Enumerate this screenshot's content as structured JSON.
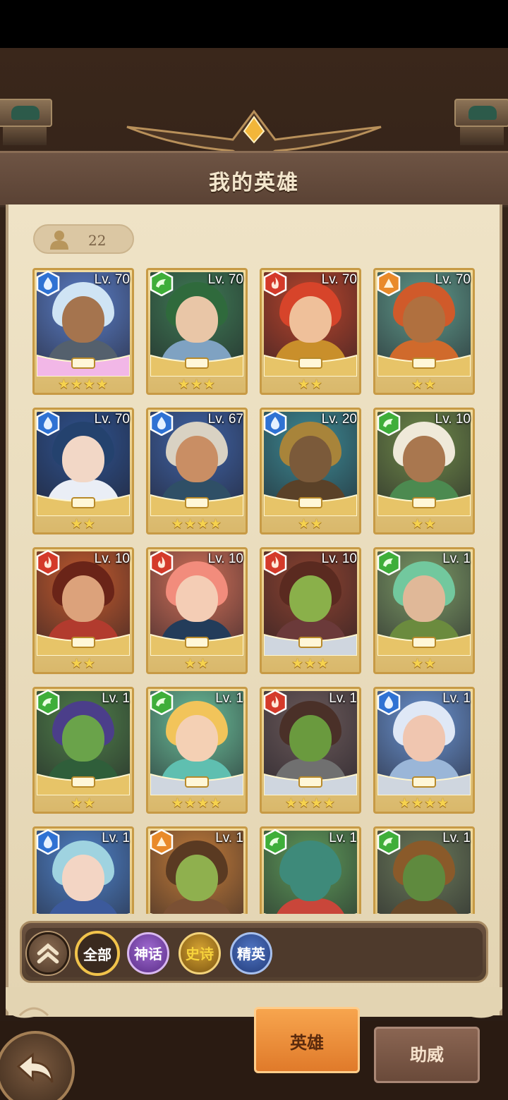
{
  "header": {
    "title": "我的英雄"
  },
  "hero_count": "22",
  "heroes": [
    {
      "level": "Lv. 70",
      "element": "water",
      "stars": "★★★★",
      "bg": "#5a7ec7",
      "hair": "#cfe4f4",
      "skin": "#a5744e",
      "outfit": "#54606d",
      "accent": "#f2b7e7"
    },
    {
      "level": "Lv. 70",
      "element": "nature",
      "stars": "★★★",
      "bg": "#3f7b55",
      "hair": "#2f6a3c",
      "skin": "#e9c6a7",
      "outfit": "#7fa2c2",
      "accent": "#e7c468"
    },
    {
      "level": "Lv. 70",
      "element": "fire",
      "stars": "★★",
      "bg": "#b8452c",
      "hair": "#d7442a",
      "skin": "#efc09a",
      "outfit": "#c98f2b",
      "accent": "#e7c468"
    },
    {
      "level": "Lv. 70",
      "element": "earth",
      "stars": "★★",
      "bg": "#5f9a8b",
      "hair": "#d05a2a",
      "skin": "#b0703f",
      "outfit": "#d06a2c",
      "accent": "#e7c468"
    },
    {
      "level": "Lv. 70",
      "element": "water",
      "stars": "★★",
      "bg": "#2f5390",
      "hair": "#24426e",
      "skin": "#f2d7c6",
      "outfit": "#eaeef6",
      "accent": "#e7c468"
    },
    {
      "level": "Lv. 67",
      "element": "water",
      "stars": "★★★★",
      "bg": "#3f63a5",
      "hair": "#d9d2c3",
      "skin": "#c98e64",
      "outfit": "#2f4f66",
      "accent": "#e7c468"
    },
    {
      "level": "Lv. 20",
      "element": "water",
      "stars": "★★",
      "bg": "#3d8a94",
      "hair": "#a8843a",
      "skin": "#7b5a3a",
      "outfit": "#5a4128",
      "accent": "#e7c468"
    },
    {
      "level": "Lv. 10",
      "element": "nature",
      "stars": "★★",
      "bg": "#6f8a4a",
      "hair": "#efe9d9",
      "skin": "#a9774f",
      "outfit": "#4c8a50",
      "accent": "#e7c468"
    },
    {
      "level": "Lv. 10",
      "element": "fire",
      "stars": "★★",
      "bg": "#c25a2e",
      "hair": "#6a2418",
      "skin": "#dca27b",
      "outfit": "#b23b2e",
      "accent": "#e7c468"
    },
    {
      "level": "Lv. 10",
      "element": "fire",
      "stars": "★★",
      "bg": "#d07058",
      "hair": "#f28c7c",
      "skin": "#f4cdb5",
      "outfit": "#233c5a",
      "accent": "#e7c468"
    },
    {
      "level": "Lv. 10",
      "element": "fire",
      "stars": "★★★",
      "bg": "#8d4330",
      "hair": "#5a2a20",
      "skin": "#8ab04a",
      "outfit": "#6b3a3a",
      "accent": "#cfd6df"
    },
    {
      "level": "Lv. 1",
      "element": "nature",
      "stars": "★★",
      "bg": "#7c9a66",
      "hair": "#72c89e",
      "skin": "#e0b898",
      "outfit": "#6b8b3e",
      "accent": "#e7c468"
    },
    {
      "level": "Lv. 1",
      "element": "nature",
      "stars": "★★",
      "bg": "#4f7f4a",
      "hair": "#4b3e8a",
      "skin": "#6aa34a",
      "outfit": "#2f5e3a",
      "accent": "#e7c468"
    },
    {
      "level": "Lv. 1",
      "element": "nature",
      "stars": "★★★★",
      "bg": "#6bbf9a",
      "hair": "#f2c45a",
      "skin": "#f4d0b4",
      "outfit": "#5fbfb0",
      "accent": "#cfd6df"
    },
    {
      "level": "Lv. 1",
      "element": "fire",
      "stars": "★★★★",
      "bg": "#6b5a5a",
      "hair": "#4a3028",
      "skin": "#6a9a3e",
      "outfit": "#707070",
      "accent": "#cfd6df"
    },
    {
      "level": "Lv. 1",
      "element": "water",
      "stars": "★★★★",
      "bg": "#6a93d0",
      "hair": "#dfe8f6",
      "skin": "#f0c6b0",
      "outfit": "#9ab6d8",
      "accent": "#cfd6df"
    },
    {
      "level": "Lv. 1",
      "element": "water",
      "stars": "",
      "bg": "#4f82c8",
      "hair": "#9fd3e0",
      "skin": "#f3d5c4",
      "outfit": "#3c5a9c",
      "accent": "#e7c468"
    },
    {
      "level": "Lv. 1",
      "element": "earth",
      "stars": "",
      "bg": "#c27c3a",
      "hair": "#5a3a22",
      "skin": "#8fb04e",
      "outfit": "#7a5034",
      "accent": "#e7c468"
    },
    {
      "level": "Lv. 1",
      "element": "nature",
      "stars": "",
      "bg": "#5e9a5a",
      "hair": "#3e8a7a",
      "skin": "#3e8a7a",
      "outfit": "#c9463a",
      "accent": "#e7c468"
    },
    {
      "level": "Lv. 1",
      "element": "nature",
      "stars": "",
      "bg": "#6b7a5a",
      "hair": "#8a5a2a",
      "skin": "#5f8a3e",
      "outfit": "#6a4a2a",
      "accent": "#e7c468"
    }
  ],
  "element_colors": {
    "water": "#2f72d3",
    "nature": "#3fae3a",
    "fire": "#d43a2a",
    "earth": "#e98a2a"
  },
  "filters": {
    "all": "全部",
    "myth": "神话",
    "epic": "史诗",
    "elite": "精英"
  },
  "tabs": {
    "heroes": "英雄",
    "assist": "助威"
  }
}
